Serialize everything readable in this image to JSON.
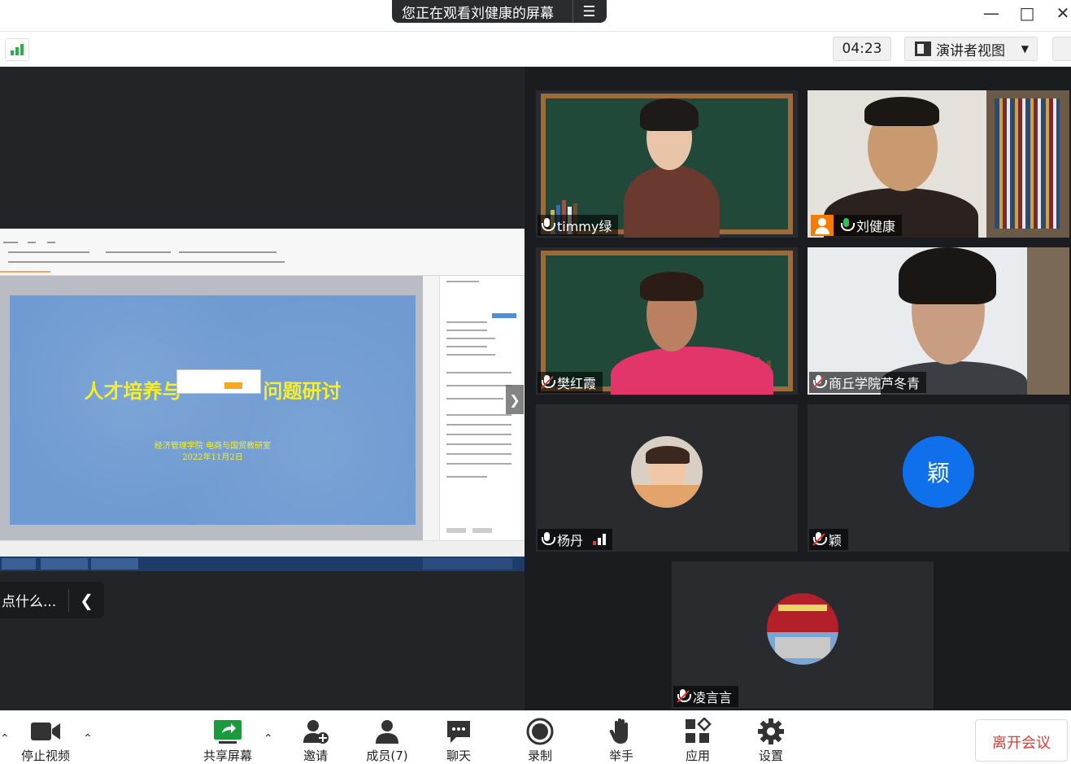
{
  "window": {
    "sharing_banner": "您正在观看刘健康的屏幕",
    "menu_icon": "hamburger-icon",
    "minimize_icon": "minimize-icon",
    "maximize_icon": "maximize-icon",
    "close_icon": "close-icon"
  },
  "toolbar_top": {
    "timer": "04:23",
    "view_label": "演讲者视图",
    "signal_icon": "signal-strength-icon",
    "fullscreen_icon": "fullscreen-icon"
  },
  "shared_screen": {
    "slide_title": "人才培养与",
    "slide_title_end": "问题研讨",
    "slide_subtitle": "经济管理学院 电商与国贸教研室",
    "slide_date": "2022年11月2日",
    "chat_preview": "点什么...",
    "chat_collapse_icon": "chevron-left-icon"
  },
  "participants": [
    {
      "name": "timmy绿",
      "mic": "on",
      "host": false,
      "active": false
    },
    {
      "name": "刘健康",
      "mic": "speaking",
      "host": true,
      "active": true
    },
    {
      "name": "樊红霞",
      "mic": "muted",
      "host": false,
      "active": false
    },
    {
      "name": "商丘学院芦冬青",
      "mic": "muted",
      "host": false,
      "active": false
    },
    {
      "name": "杨丹",
      "mic": "on",
      "host": false,
      "active": false,
      "avatar": "photo"
    },
    {
      "name": "颖",
      "mic": "muted",
      "host": false,
      "active": false,
      "avatar_letter": "颖"
    },
    {
      "name": "凌言言",
      "mic": "muted",
      "host": false,
      "active": false,
      "avatar": "photo"
    }
  ],
  "bottom_toolbar": {
    "video_label": "停止视频",
    "share_label": "共享屏幕",
    "invite_label": "邀请",
    "members_label": "成员(7)",
    "chat_label": "聊天",
    "record_label": "录制",
    "raise_hand_label": "举手",
    "apps_label": "应用",
    "settings_label": "设置",
    "leave_label": "离开会议"
  },
  "colors": {
    "accent_green": "#2fc25b",
    "accent_blue": "#0e71eb",
    "leave_red": "#e53935",
    "slide_title_yellow": "#f6ef2a"
  }
}
